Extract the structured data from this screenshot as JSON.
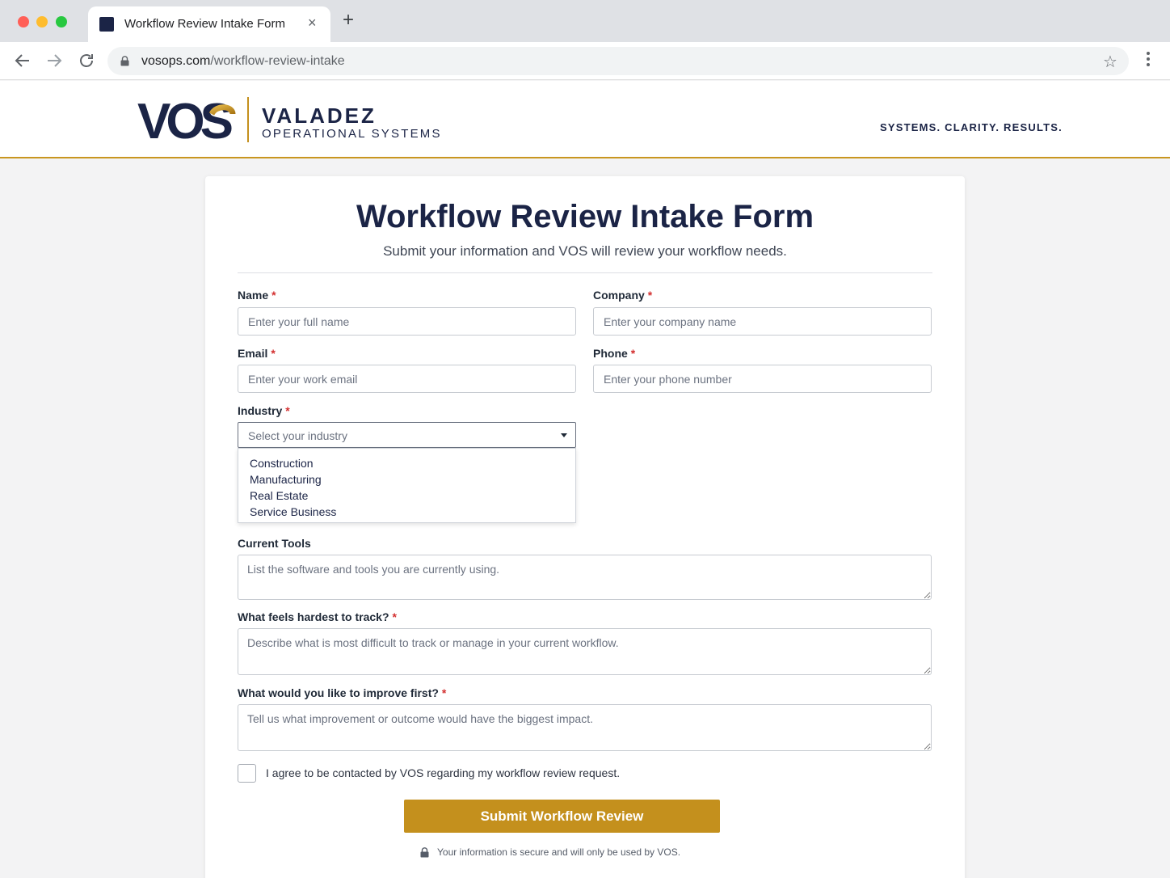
{
  "browser": {
    "tab_title": "Workflow Review Intake Form",
    "tab_close": "×",
    "new_tab": "+",
    "url_domain": "vosops.com",
    "url_path": "/workflow-review-intake",
    "star": "☆"
  },
  "site": {
    "logo_text": "VOS",
    "brand_name": "VALADEZ",
    "brand_sub": "OPERATIONAL SYSTEMS",
    "tagline": "SYSTEMS. CLARITY. RESULTS.",
    "accent_color": "#c4901d",
    "brand_color": "#1b2446"
  },
  "form": {
    "title": "Workflow Review Intake Form",
    "subtitle": "Submit your information and VOS will review your workflow needs.",
    "required_mark": "*",
    "fields": {
      "name": {
        "label": "Name",
        "placeholder": "Enter your full name",
        "value": ""
      },
      "company": {
        "label": "Company",
        "placeholder": "Enter your company name",
        "value": ""
      },
      "email": {
        "label": "Email",
        "placeholder": "Enter your work email",
        "value": ""
      },
      "phone": {
        "label": "Phone",
        "placeholder": "Enter your phone number",
        "value": ""
      },
      "industry": {
        "label": "Industry",
        "placeholder": "Select your industry",
        "options": [
          "Construction",
          "Manufacturing",
          "Real Estate",
          "Service Business"
        ]
      },
      "current_tools": {
        "label": "Current Tools",
        "placeholder": "List the software and tools you are currently using."
      },
      "hardest_to_track": {
        "label": "What feels hardest to track?",
        "placeholder": "Describe what is most difficult to track or manage in your current workflow."
      },
      "improve_first": {
        "label": "What would you like to improve first?",
        "placeholder": "Tell us what improvement or outcome would have the biggest impact."
      }
    },
    "consent_label": "I agree to be contacted by VOS regarding my workflow review request.",
    "consent_checked": false,
    "submit_label": "Submit Workflow Review",
    "secure_note": "Your information is secure and will only be used by VOS."
  }
}
